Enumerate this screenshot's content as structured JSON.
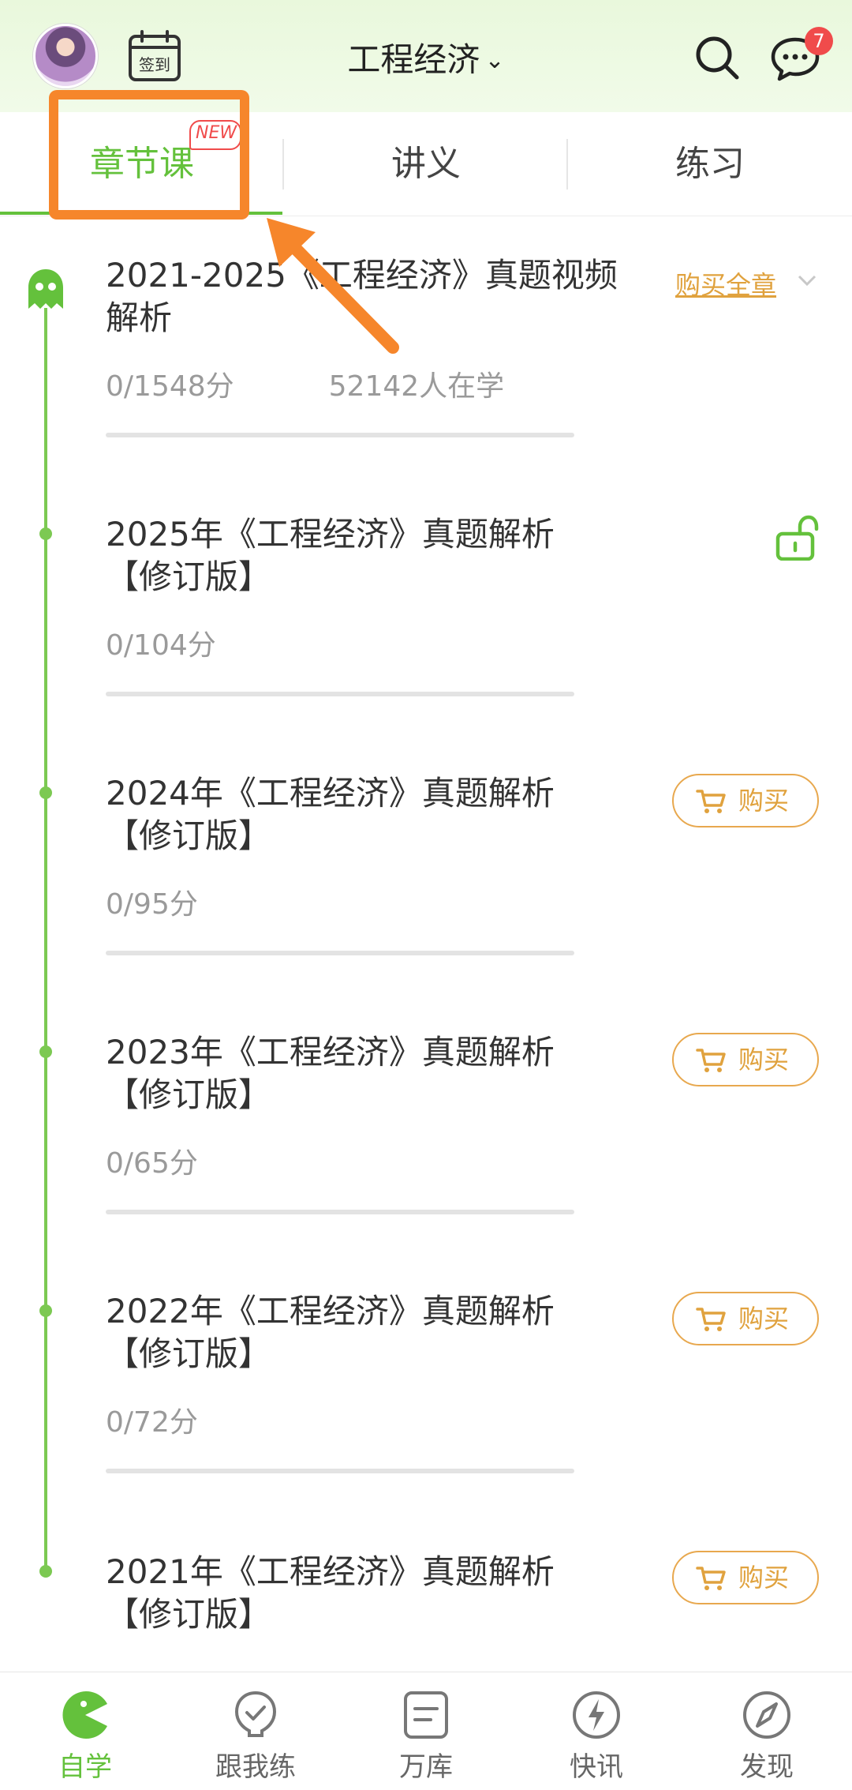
{
  "header": {
    "title": "工程经济",
    "checkin_label": "签到",
    "message_count": "7"
  },
  "tabs": [
    {
      "label": "章节课",
      "tag": "NEW"
    },
    {
      "label": "讲义"
    },
    {
      "label": "练习"
    }
  ],
  "chapter": {
    "title": "2021-2025《工程经济》真题视频解析",
    "score": "0/1548分",
    "learners": "52142人在学",
    "buy_all_label": "购买全章"
  },
  "items": [
    {
      "title": "2025年《工程经济》真题解析【修订版】",
      "score": "0/104分",
      "action": "unlocked"
    },
    {
      "title": "2024年《工程经济》真题解析【修订版】",
      "score": "0/95分",
      "action": "购买"
    },
    {
      "title": "2023年《工程经济》真题解析【修订版】",
      "score": "0/65分",
      "action": "购买"
    },
    {
      "title": "2022年《工程经济》真题解析【修订版】",
      "score": "0/72分",
      "action": "购买"
    },
    {
      "title": "2021年《工程经济》真题解析【修订版】",
      "score": "",
      "action": "购买"
    }
  ],
  "bottom_nav": [
    {
      "label": "自学",
      "icon": "pacman-icon"
    },
    {
      "label": "跟我练",
      "icon": "check-bulb-icon"
    },
    {
      "label": "万库",
      "icon": "document-icon"
    },
    {
      "label": "快讯",
      "icon": "lightning-icon"
    },
    {
      "label": "发现",
      "icon": "compass-icon"
    }
  ],
  "colors": {
    "accent": "#64c13c",
    "buy": "#e0a23e",
    "highlight": "#f6862b",
    "badge": "#f04b4b"
  }
}
